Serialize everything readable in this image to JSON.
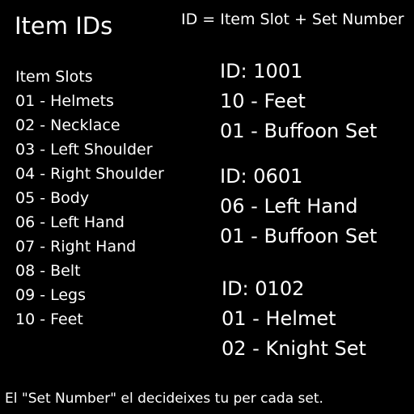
{
  "title": "Item IDs",
  "formula": "ID = Item Slot + Set Number",
  "slots": {
    "heading": "Item Slots",
    "items": [
      "01 - Helmets",
      "02 - Necklace",
      "03 - Left Shoulder",
      "04 - Right Shoulder",
      "05 - Body",
      "06 - Left Hand",
      "07 - Right Hand",
      "08 - Belt",
      "09 - Legs",
      "10 - Feet"
    ]
  },
  "examples": [
    {
      "id": "ID: 1001",
      "slot": "10 - Feet",
      "set": "01 - Buffoon Set"
    },
    {
      "id": "ID: 0601",
      "slot": "06 - Left Hand",
      "set": "01 - Buffoon Set"
    },
    {
      "id": "ID: 0102",
      "slot": "01 - Helmet",
      "set": "02 - Knight Set"
    }
  ],
  "footnote": "El \"Set Number\" el decideixes tu per cada set.",
  "colors": {
    "background": "#000000",
    "text": "#ffffff"
  }
}
